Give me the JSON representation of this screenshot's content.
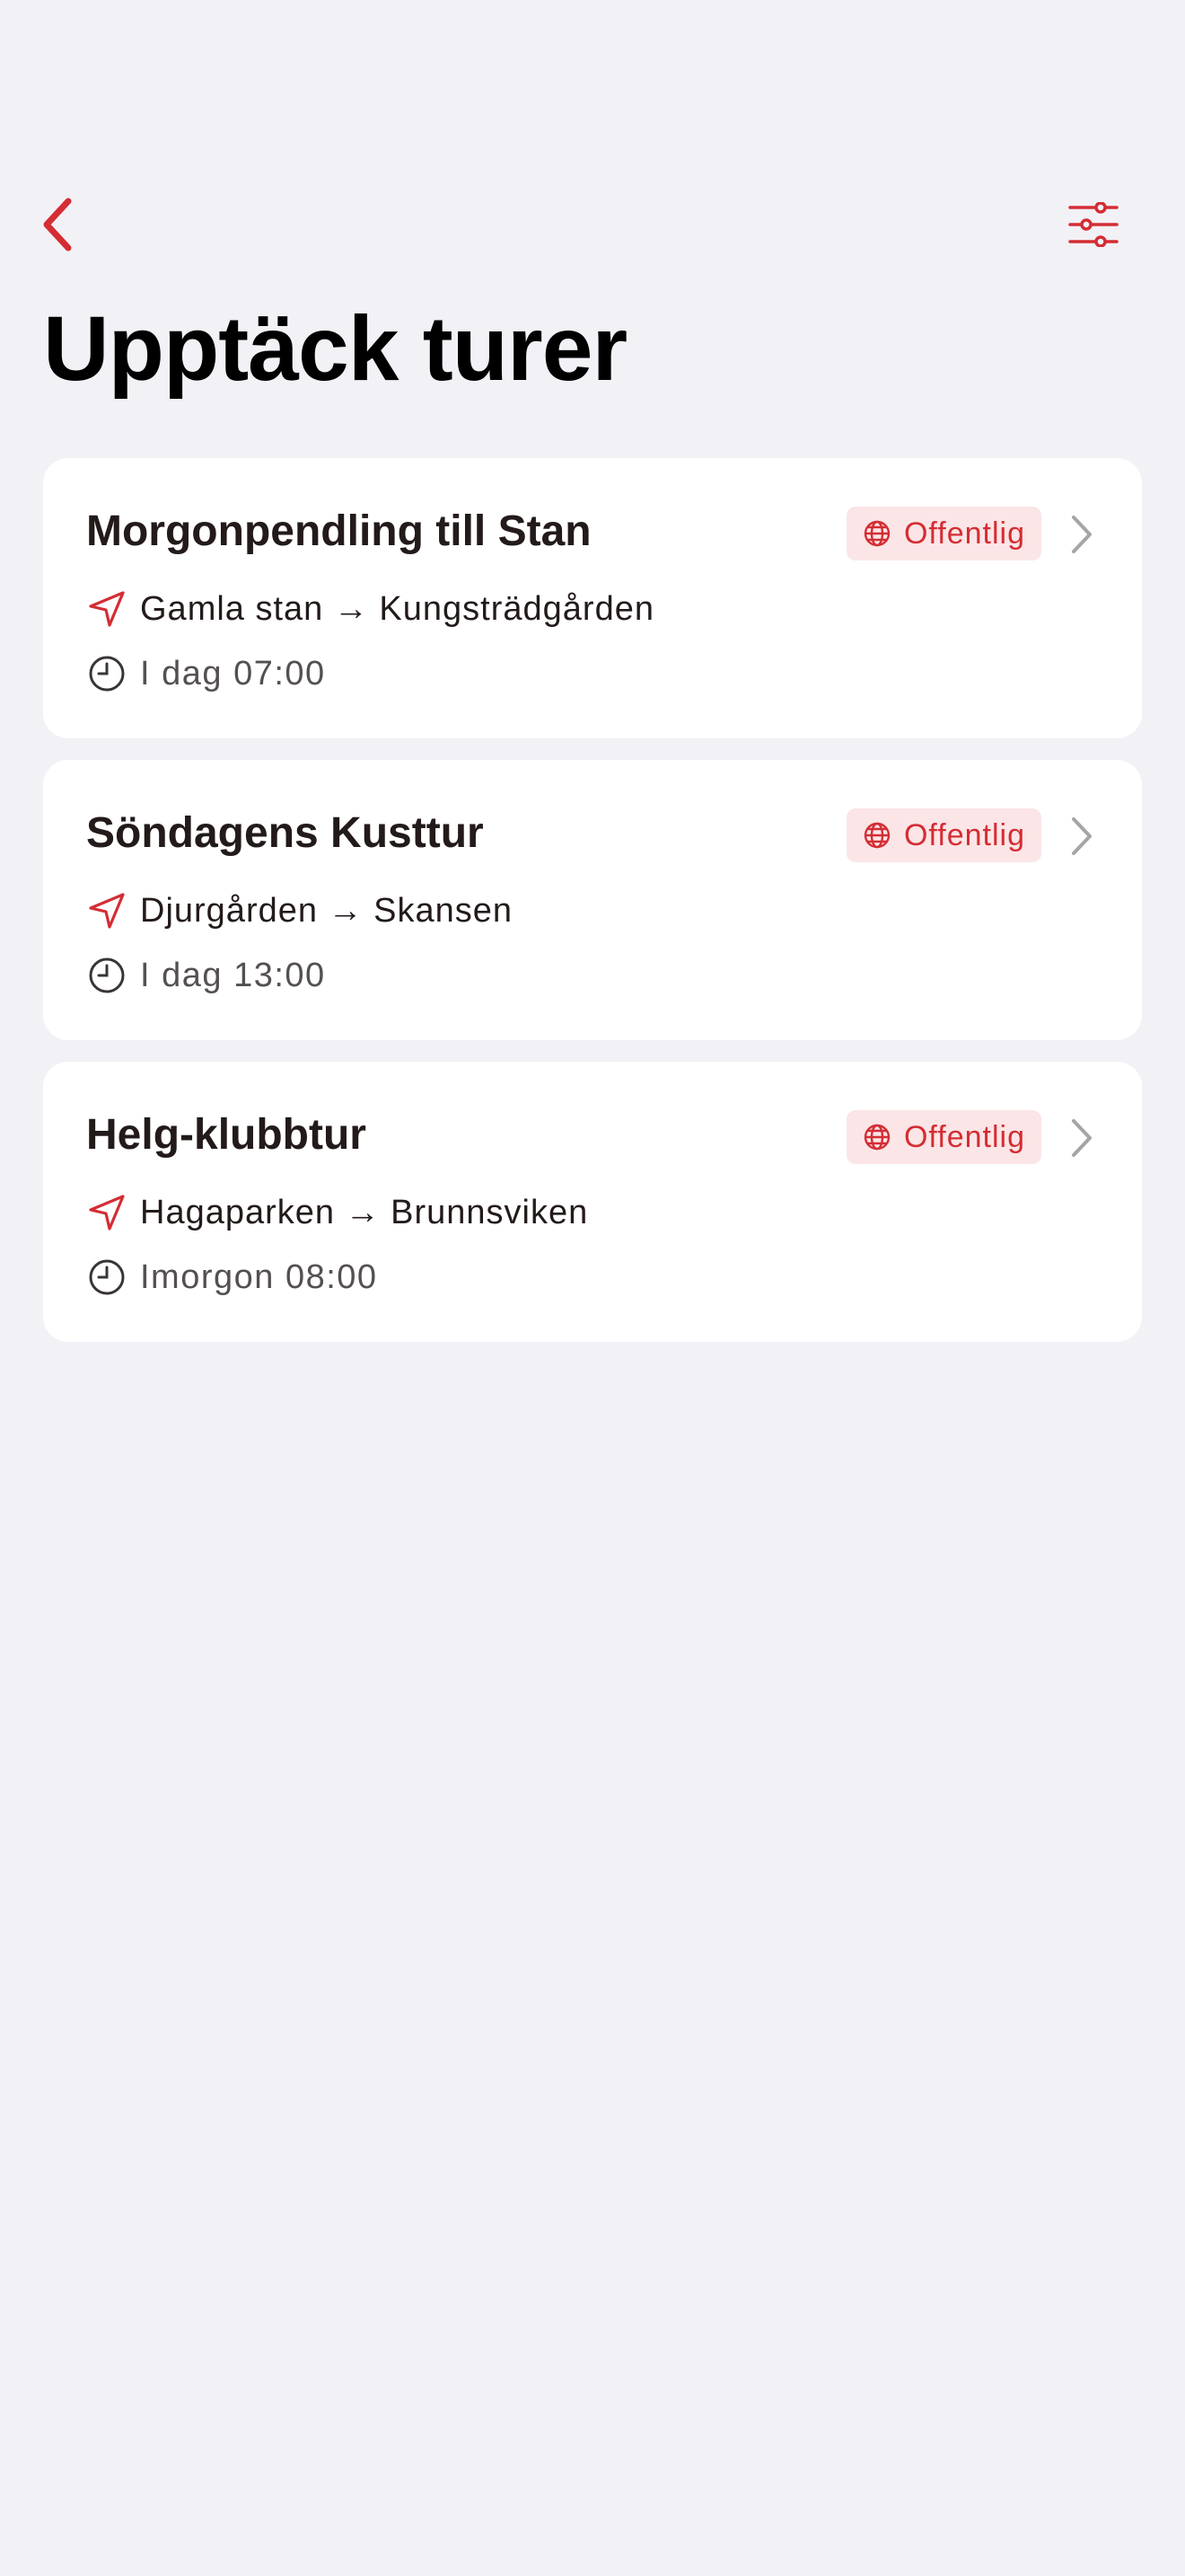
{
  "nav": {
    "back_icon": "chevron-left-icon",
    "filter_icon": "sliders-icon"
  },
  "page": {
    "title": "Upptäck turer"
  },
  "colors": {
    "accent": "#d42d34",
    "badge_bg": "#fbe5e6",
    "background": "#f2f1f6",
    "card": "#ffffff",
    "chevron": "#a8a4a4"
  },
  "trips": [
    {
      "title": "Morgonpendling till Stan",
      "visibility": "Offentlig",
      "route": "Gamla stan → Kungsträdgården",
      "time": "I dag 07:00"
    },
    {
      "title": "Söndagens Kusttur",
      "visibility": "Offentlig",
      "route": "Djurgården → Skansen",
      "time": "I dag 13:00"
    },
    {
      "title": "Helg-klubbtur",
      "visibility": "Offentlig",
      "route": "Hagaparken → Brunnsviken",
      "time": "Imorgon 08:00"
    }
  ]
}
